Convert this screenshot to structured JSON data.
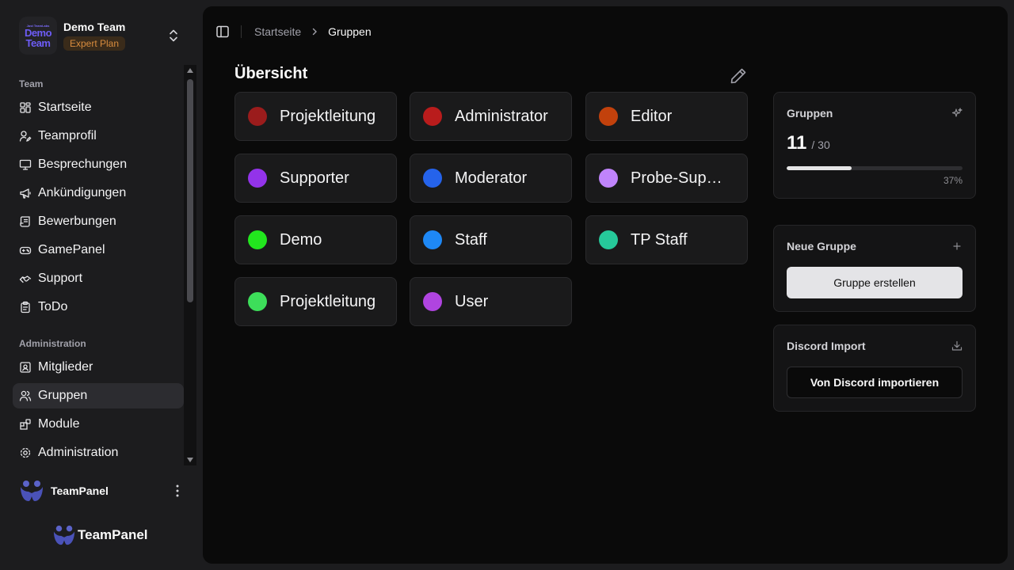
{
  "team": {
    "logo_small_text": "Just TeamLabs",
    "logo_line1": "Demo",
    "logo_line2": "Team",
    "name": "Demo Team",
    "plan": "Expert Plan"
  },
  "sidebar": {
    "section_team": "Team",
    "team_items": [
      {
        "label": "Startseite",
        "icon": "grid-icon"
      },
      {
        "label": "Teamprofil",
        "icon": "user-pen-icon"
      },
      {
        "label": "Besprechungen",
        "icon": "presentation-icon"
      },
      {
        "label": "Ankündigungen",
        "icon": "megaphone-icon"
      },
      {
        "label": "Bewerbungen",
        "icon": "scroll-icon"
      },
      {
        "label": "GamePanel",
        "icon": "gamepad-icon"
      },
      {
        "label": "Support",
        "icon": "handshake-icon"
      },
      {
        "label": "ToDo",
        "icon": "clipboard-icon"
      }
    ],
    "section_admin": "Administration",
    "admin_items": [
      {
        "label": "Mitglieder",
        "icon": "contact-icon"
      },
      {
        "label": "Gruppen",
        "icon": "users-icon",
        "active": true
      },
      {
        "label": "Module",
        "icon": "blocks-icon"
      },
      {
        "label": "Administration",
        "icon": "settings-icon"
      }
    ]
  },
  "user": {
    "name": "TeamPanel"
  },
  "brand": {
    "name": "TeamPanel"
  },
  "breadcrumb": {
    "home": "Startseite",
    "current": "Gruppen"
  },
  "main": {
    "heading": "Übersicht",
    "groups": [
      {
        "name": "Projektleitung",
        "color": "#9b1c1c"
      },
      {
        "name": "Administrator",
        "color": "#b91c1c"
      },
      {
        "name": "Editor",
        "color": "#c2410c"
      },
      {
        "name": "Supporter",
        "color": "#9333ea"
      },
      {
        "name": "Moderator",
        "color": "#2563eb"
      },
      {
        "name": "Probe-Supporter",
        "color": "#c084fc"
      },
      {
        "name": "Demo",
        "color": "#22e61e"
      },
      {
        "name": "Staff",
        "color": "#1e88f5"
      },
      {
        "name": "TP Staff",
        "color": "#26c99a"
      },
      {
        "name": "Projektleitung",
        "color": "#3dde5a"
      },
      {
        "name": "User",
        "color": "#b044e0"
      }
    ]
  },
  "stats": {
    "title": "Gruppen",
    "count": "11",
    "limit": "/ 30",
    "percent_label": "37%",
    "percent_value": 0.37
  },
  "new_group": {
    "title": "Neue Gruppe",
    "button": "Gruppe erstellen"
  },
  "discord": {
    "title": "Discord Import",
    "button": "Von Discord importieren"
  }
}
